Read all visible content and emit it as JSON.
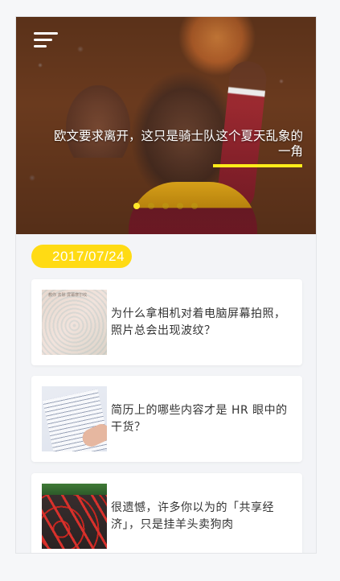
{
  "hero": {
    "title": "欧文要求离开，这只是骑士队这个夏天乱象的一角",
    "slide_count": 5,
    "active_slide": 0,
    "accent_color": "#ffec1a"
  },
  "menu": {
    "icon": "menu-icon"
  },
  "date": "2017/07/24",
  "articles": [
    {
      "title": "为什么拿相机对着电脑屏幕拍照，照片总会出现波纹？"
    },
    {
      "title": "简历上的哪些内容才是 HR 眼中的干货？"
    },
    {
      "title": "很遗憾，许多你以为的「共享经济」，只是挂羊头卖狗肉"
    }
  ],
  "colors": {
    "date_pill": "#ffdb14",
    "card_bg": "#ffffff",
    "page_bg": "#f3f4f7"
  }
}
